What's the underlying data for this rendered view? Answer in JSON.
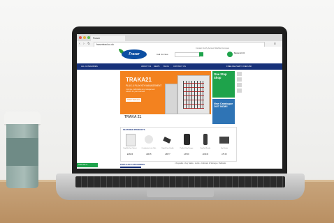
{
  "browser": {
    "tab_title": "Fraser",
    "url": "fraserlead.co.uk",
    "traffic_lights": [
      "#e2584f",
      "#e4b33d",
      "#5cbf52"
    ]
  },
  "site": {
    "logo_text": "Fraser",
    "phone": "Call Us Now",
    "top_links": "Contact Us   My Account   Wishlist   Compare",
    "basket": "Basket £0.00"
  },
  "nav": {
    "items": [
      "ALL CATEGORIES",
      "",
      "ABOUT US",
      "NEWS",
      "BLOG",
      "CONTACT US",
      "FREE DELIVERY OVER £50"
    ]
  },
  "hero": {
    "title": "TRAKA21",
    "subtitle": "PLUG & PLAY KEY MANAGEMENT",
    "body": "A simple & affordable key management solution for your business",
    "button": "SHOP TRAKA21",
    "footer_label": "TRAKA 21"
  },
  "promos": {
    "one_stop": "One Stop Shop",
    "catalogue": "New Catalogue OUT NOW!"
  },
  "featured": {
    "title": "FEATURED PRODUCTS",
    "products": [
      {
        "name": "KeySafe Key Cabinet",
        "price": "£249.00"
      },
      {
        "name": "Combination Lock Safe",
        "price": "£99.95"
      },
      {
        "name": "Digital Door Handle",
        "price": "£89.77"
      },
      {
        "name": "Padlock Key Storage",
        "price": "£35.00"
      },
      {
        "name": "Key Fob Reader",
        "price": "£169.00"
      },
      {
        "name": "Key Station",
        "price": "£75.00"
      }
    ]
  },
  "popular": {
    "title": "POPULAR CATEGORIES",
    "filters": "• Keysafes   • Key Safes   • Locks   • Cabinets & Storage   • Padlocks"
  },
  "chat": {
    "label": "Chat with us"
  }
}
